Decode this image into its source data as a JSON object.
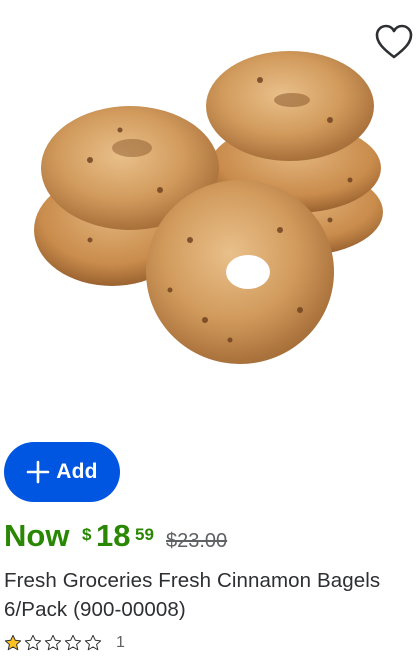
{
  "product": {
    "image_alt": "Fresh Cinnamon Bagels",
    "favorite_icon": "heart-outline-icon",
    "add_button": {
      "icon": "plus-icon",
      "label": "Add"
    },
    "price": {
      "prefix": "Now",
      "currency": "$",
      "dollars": "18",
      "cents": "59",
      "was": "$23.00"
    },
    "title": "Fresh Groceries Fresh Cinnamon Bagels 6/Pack (900-00008)",
    "rating": {
      "stars": 1,
      "max": 5,
      "count": "1"
    },
    "colors": {
      "accent": "#0056e0",
      "price": "#2a8703",
      "star": "#ffc220"
    }
  }
}
